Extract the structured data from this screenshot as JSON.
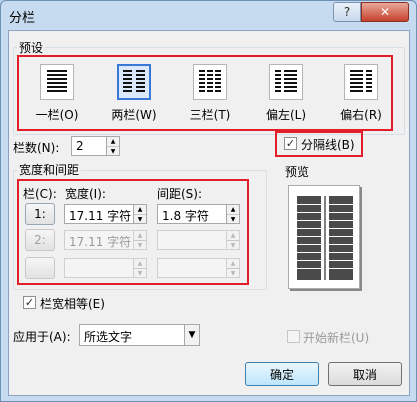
{
  "window": {
    "title": "分栏",
    "help_label": "?",
    "close_label": "✕"
  },
  "presets": {
    "label": "预设",
    "items": [
      {
        "label": "一栏(O)",
        "icon": "one-column-icon",
        "selected": false
      },
      {
        "label": "两栏(W)",
        "icon": "two-columns-icon",
        "selected": true
      },
      {
        "label": "三栏(T)",
        "icon": "three-columns-icon",
        "selected": false
      },
      {
        "label": "偏左(L)",
        "icon": "left-narrow-icon",
        "selected": false
      },
      {
        "label": "偏右(R)",
        "icon": "right-narrow-icon",
        "selected": false
      }
    ]
  },
  "column_count": {
    "label": "栏数(N):",
    "value": "2"
  },
  "separator": {
    "label": "分隔线(B)",
    "checked": true,
    "mark": "✓"
  },
  "width_spacing": {
    "label": "宽度和间距",
    "col_header": "栏(C):",
    "width_header": "宽度(I):",
    "spacing_header": "间距(S):",
    "rows": [
      {
        "col": "1:",
        "width": "17.11 字符",
        "spacing": "1.8 字符",
        "enabled": true
      },
      {
        "col": "2:",
        "width": "17.11 字符",
        "spacing": "",
        "enabled": false
      },
      {
        "col": "",
        "width": "",
        "spacing": "",
        "enabled": false
      }
    ]
  },
  "equal_width": {
    "label": "栏宽相等(E)",
    "checked": true,
    "mark": "✓"
  },
  "preview": {
    "label": "预览"
  },
  "apply_to": {
    "label": "应用于(A):",
    "value": "所选文字"
  },
  "new_column": {
    "label": "开始新栏(U)",
    "checked": false
  },
  "buttons": {
    "ok": "确定",
    "cancel": "取消"
  },
  "colors": {
    "highlight": "#e31d2a",
    "selected_border": "#3a78d8"
  }
}
